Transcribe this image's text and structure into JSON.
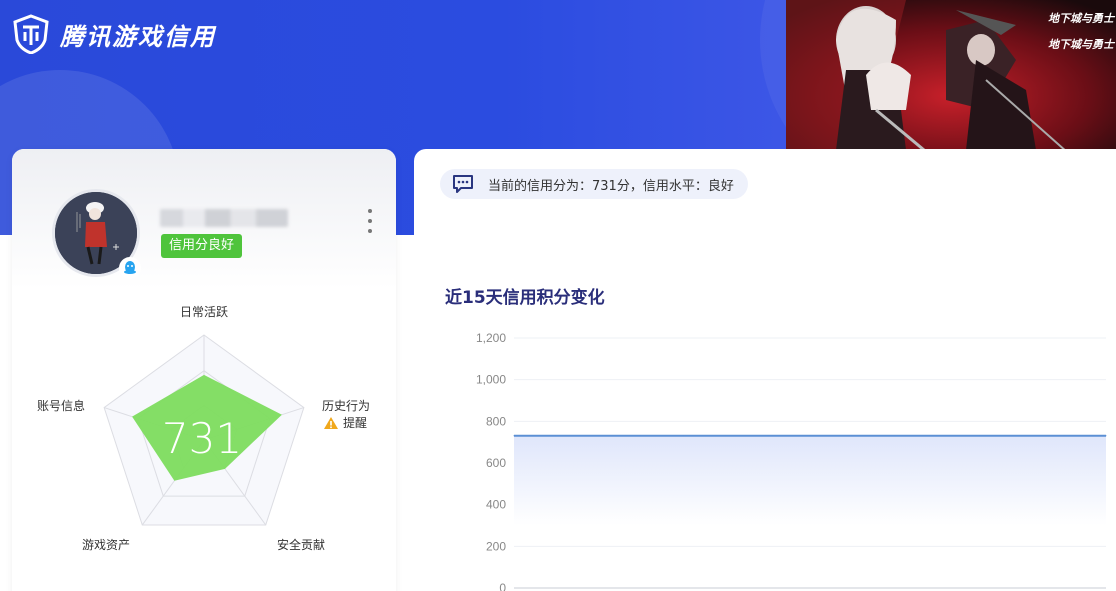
{
  "header": {
    "app_title": "腾讯游戏信用"
  },
  "banner": {
    "game_logo_text": "地下城与勇士",
    "game_logo_text2": "地下城与勇士"
  },
  "profile": {
    "status_badge": "信用分良好",
    "more_icon": "more-vertical-icon",
    "platform_icon": "qq-icon"
  },
  "radar": {
    "score": "731",
    "axes": [
      "日常活跃",
      "历史行为",
      "安全贡献",
      "游戏资产",
      "账号信息"
    ],
    "warning_label": "提醒",
    "values": [
      0.62,
      0.78,
      0.34,
      0.48,
      0.72
    ],
    "fill_color": "#7ddc5e"
  },
  "notice": {
    "icon": "message-icon",
    "text": "当前的信用分为：731分，信用水平：良好"
  },
  "chart_data": {
    "type": "area",
    "title": "近15天信用积分变化",
    "y_ticks": [
      "1,200",
      "1,000",
      "800",
      "600",
      "400",
      "200",
      "0"
    ],
    "ylim": [
      0,
      1200
    ],
    "series": [
      {
        "values": [
          731,
          731,
          731,
          731,
          731,
          731,
          731,
          731,
          731,
          731,
          731,
          731,
          731,
          731,
          731
        ]
      }
    ],
    "line_color": "#5b8fd4",
    "grid": true
  }
}
